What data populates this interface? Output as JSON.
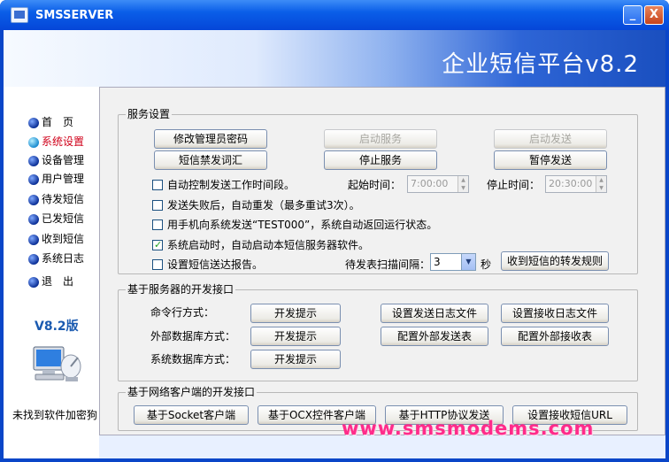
{
  "window": {
    "title": "SMSSERVER",
    "minimize": "_",
    "close": "X"
  },
  "banner": {
    "title": "企业短信平台v8.2"
  },
  "nav": {
    "items": [
      {
        "label": "首　页"
      },
      {
        "label": "系统设置",
        "active": true
      },
      {
        "label": "设备管理"
      },
      {
        "label": "用户管理"
      },
      {
        "label": "待发短信"
      },
      {
        "label": "已发短信"
      },
      {
        "label": "收到短信"
      },
      {
        "label": "系统日志"
      },
      {
        "label": "退　出"
      }
    ]
  },
  "version": "V8.2版",
  "nokey": "未找到软件加密狗",
  "service": {
    "group_label": "服务设置",
    "btn_change_pwd": "修改管理员密码",
    "btn_start_service": "启动服务",
    "btn_start_send": "启动发送",
    "btn_banned_words": "短信禁发词汇",
    "btn_stop_service": "停止服务",
    "btn_pause_send": "暂停发送",
    "chk_auto_time": "自动控制发送工作时间段。",
    "start_time_label": "起始时间：",
    "start_time": "7:00:00",
    "stop_time_label": "停止时间：",
    "stop_time": "20:30:00",
    "chk_retry": "发送失败后，自动重发（最多重试3次）。",
    "chk_test": "用手机向系统发送“TEST000”，系统自动返回运行状态。",
    "chk_autostart": "系统启动时，自动启动本短信服务器软件。",
    "chk_report": "设置短信送达报告。",
    "scan_label": "待发表扫描间隔：",
    "scan_value": "3",
    "scan_unit": "秒",
    "btn_forward_rules": "收到短信的转发规则"
  },
  "server_dev": {
    "group_label": "基于服务器的开发接口",
    "row1_label": "命令行方式：",
    "row2_label": "外部数据库方式：",
    "row3_label": "系统数据库方式：",
    "btn_dev_hint": "开发提示",
    "btn_send_log": "设置发送日志文件",
    "btn_recv_log": "设置接收日志文件",
    "btn_ext_send": "配置外部发送表",
    "btn_ext_recv": "配置外部接收表"
  },
  "client_dev": {
    "group_label": "基于网络客户端的开发接口",
    "btn_socket": "基于Socket客户端",
    "btn_ocx": "基于OCX控件客户端",
    "btn_http": "基于HTTP协议发送",
    "btn_url": "设置接收短信URL"
  },
  "watermark": "www.smsmodems.com"
}
